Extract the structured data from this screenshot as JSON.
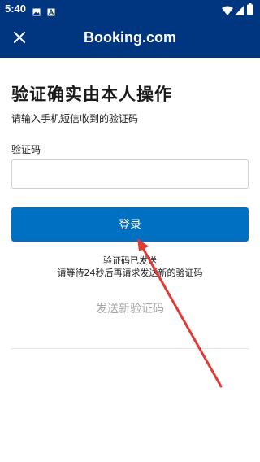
{
  "status_bar": {
    "time": "5:40",
    "left_icons": [
      "image-icon",
      "text-a-icon"
    ],
    "right_icons": [
      "wifi-icon",
      "signal-icon",
      "battery-icon"
    ]
  },
  "header": {
    "brand": "Booking.com",
    "close_icon": "close-icon",
    "background": "#003580"
  },
  "main": {
    "title": "验证确实由本人操作",
    "subtitle": "请输入手机短信收到的验证码",
    "code_label": "验证码",
    "code_value": "",
    "login_label": "登录",
    "sent_note": "验证码已发送",
    "wait_note": "请等待24秒后再请求发送新的验证码",
    "resend_label": "发送新验证码",
    "accent": "#0071c2"
  },
  "annotation": {
    "arrow_color": "#e53935"
  }
}
